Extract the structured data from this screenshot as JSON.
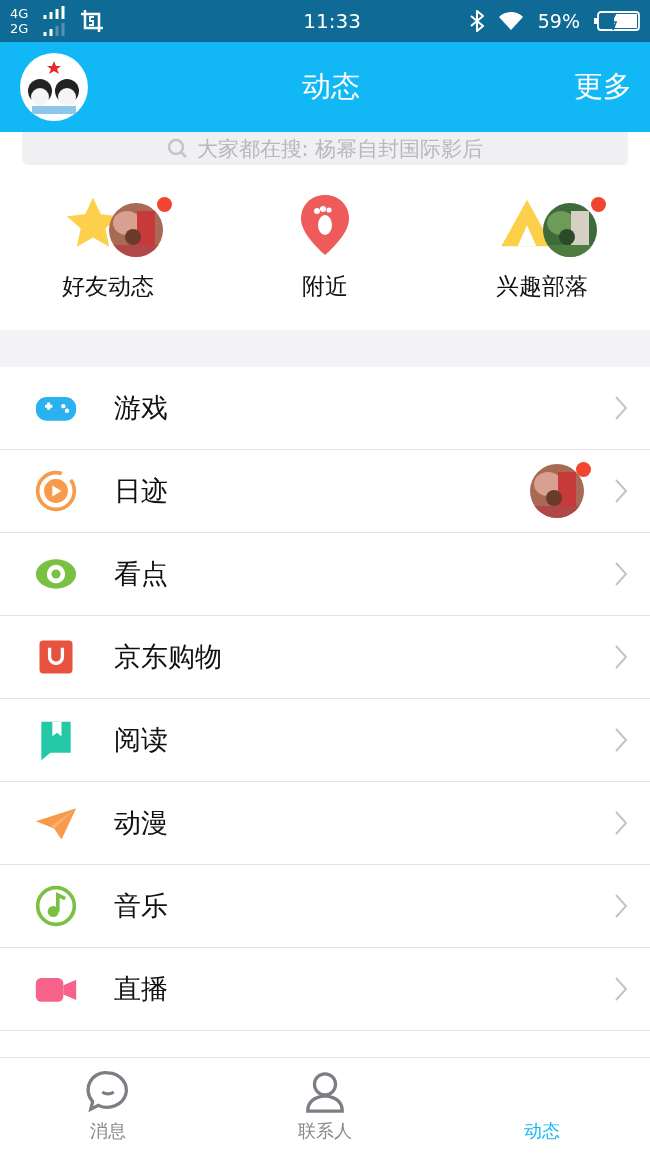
{
  "status_bar": {
    "network_1": "4G",
    "network_2": "2G",
    "time": "11:33",
    "battery": "59%"
  },
  "header": {
    "title": "动态",
    "more": "更多"
  },
  "search": {
    "placeholder": "大家都在搜: 杨幂自封国际影后"
  },
  "shortcuts": [
    {
      "label": "好友动态",
      "kind": "star",
      "new": true
    },
    {
      "label": "附近",
      "kind": "pin",
      "new": false
    },
    {
      "label": "兴趣部落",
      "kind": "tent",
      "new": true
    }
  ],
  "rows": [
    {
      "label": "游戏",
      "kind": "gamepad",
      "new": false
    },
    {
      "label": "日迹",
      "kind": "play",
      "new": true
    },
    {
      "label": "看点",
      "kind": "eye",
      "new": false
    },
    {
      "label": "京东购物",
      "kind": "bag",
      "new": false
    },
    {
      "label": "阅读",
      "kind": "book",
      "new": false
    },
    {
      "label": "动漫",
      "kind": "plane",
      "new": false
    },
    {
      "label": "音乐",
      "kind": "music",
      "new": false
    },
    {
      "label": "直播",
      "kind": "camera",
      "new": false
    }
  ],
  "tabs": [
    {
      "label": "消息",
      "kind": "chat",
      "selected": false
    },
    {
      "label": "联系人",
      "kind": "person",
      "selected": false
    },
    {
      "label": "动态",
      "kind": "hidden",
      "selected": true
    }
  ]
}
